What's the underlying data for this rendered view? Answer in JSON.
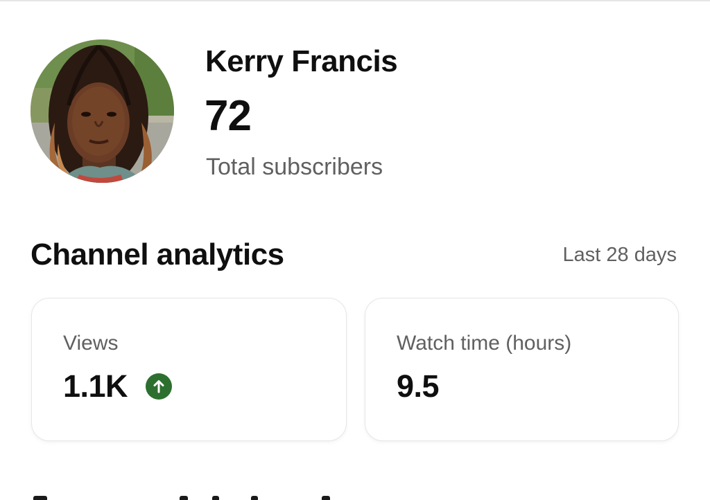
{
  "profile": {
    "channel_name": "Kerry Francis",
    "subscriber_count": "72",
    "subscriber_label": "Total subscribers"
  },
  "analytics": {
    "title": "Channel analytics",
    "period": "Last 28 days",
    "cards": [
      {
        "label": "Views",
        "value": "1.1K",
        "trend": "up",
        "trend_icon": "arrow-up-circle-icon"
      },
      {
        "label": "Watch time (hours)",
        "value": "9.5"
      }
    ]
  },
  "colors": {
    "text_primary": "#0f0f0f",
    "text_secondary": "#606060",
    "trend_up": "#2d6f2f",
    "card_border": "#e6e6e6"
  }
}
